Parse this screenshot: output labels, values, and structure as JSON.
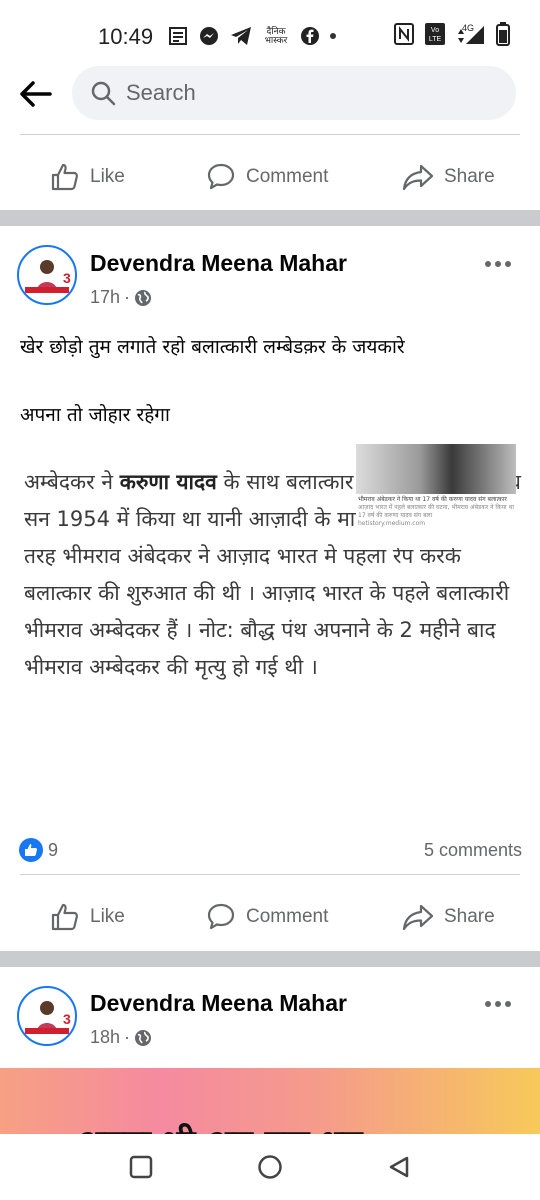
{
  "status_bar": {
    "time": "10:49",
    "bhaskar_text": "दैनिक भास्कर",
    "network": "4G",
    "volte": "Vo LTE"
  },
  "search": {
    "placeholder": "Search"
  },
  "actions": {
    "like": "Like",
    "comment": "Comment",
    "share": "Share"
  },
  "post1": {
    "author": "Devendra Meena Mahar",
    "time": "17h",
    "line1": "खेर छोड़ो तुम लगाते रहो बलात्कारी लम्बेडक़र के जयकारे",
    "line2": "अपना तो जोहार रहेगा",
    "image": {
      "text_part1": "अम्बेदकर ने ",
      "text_bold": "करुणा यादव",
      "text_part2": " के साथ बलात्कार का ये घिनौना अपराध सन 1954 में किया था यानी आज़ादी के मात्र 7 साल बाद । इस तरह भीमराव अंबेदकर ने आज़ाद भारत मे पहला रेप करके बलात्कार की शुरुआत की थी । आज़ाद भारत के पहले बलात्कारी भीमराव अम्बेदकर हैं । नोट: बौद्ध पंथ अपनाने के 2 महीने बाद भीमराव अम्बेदकर की मृत्यु हो गई थी ।",
      "thumb_caption": "भीमराव अंबेडकर ने किया था 17 वर्ष की करुणा यादव संग बलात्कार",
      "thumb_sub": "आज़ाद भारत में पहले बलात्कार की घटना, भीमराव अंबेडकर ने किया था 17 वर्ष की करुणा यादव संग बला",
      "thumb_source": "hetistory.medium.com"
    },
    "reaction_count": "9",
    "comment_count": "5 comments"
  },
  "post2": {
    "author": "Devendra Meena Mahar",
    "time": "18h",
    "banner_text": "अपना भी अब एक धम"
  },
  "colors": {
    "accent": "#1877f2",
    "secondary_text": "#65676b",
    "separator": "#cacbcf"
  }
}
